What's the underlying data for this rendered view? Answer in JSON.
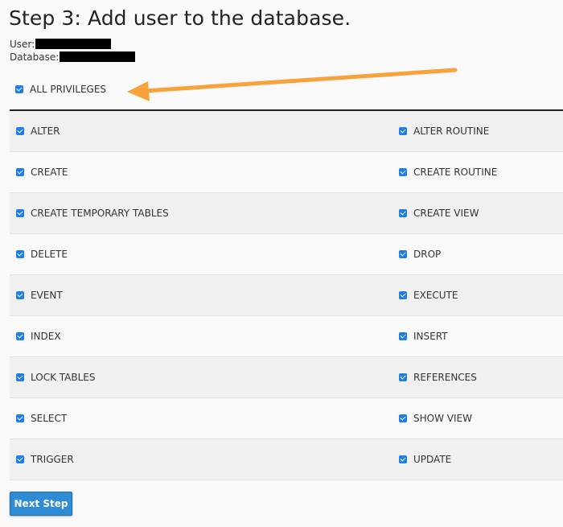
{
  "page": {
    "title": "Step 3: Add user to the database.",
    "user_label": "User:",
    "database_label": "Database:"
  },
  "all_privileges": {
    "label": "ALL PRIVILEGES",
    "checked": true
  },
  "annotation": {
    "arrow_color": "#f7a23a",
    "icon": "arrow-left-icon"
  },
  "privileges": [
    {
      "left": "ALTER",
      "right": "ALTER ROUTINE"
    },
    {
      "left": "CREATE",
      "right": "CREATE ROUTINE"
    },
    {
      "left": "CREATE TEMPORARY TABLES",
      "right": "CREATE VIEW"
    },
    {
      "left": "DELETE",
      "right": "DROP"
    },
    {
      "left": "EVENT",
      "right": "EXECUTE"
    },
    {
      "left": "INDEX",
      "right": "INSERT"
    },
    {
      "left": "LOCK TABLES",
      "right": "REFERENCES"
    },
    {
      "left": "SELECT",
      "right": "SHOW VIEW"
    },
    {
      "left": "TRIGGER",
      "right": "UPDATE"
    }
  ],
  "actions": {
    "next_step_label": "Next Step"
  },
  "colors": {
    "accent": "#2f8bd4",
    "checkbox": "#1e7ee6"
  }
}
